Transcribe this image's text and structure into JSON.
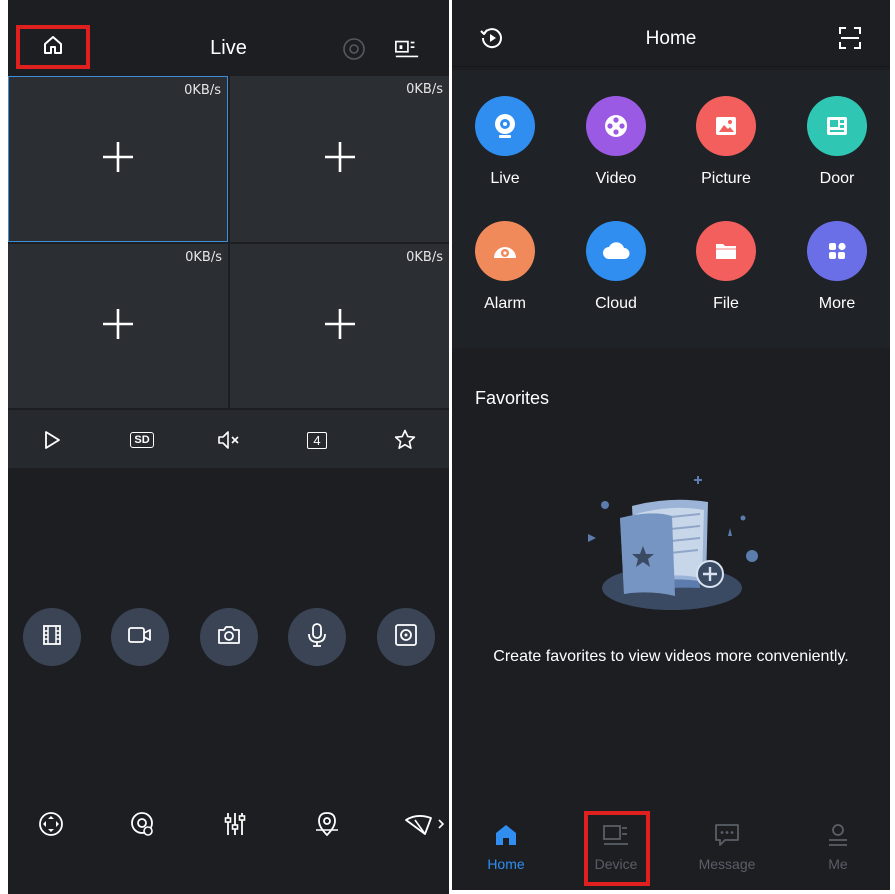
{
  "left": {
    "title": "Live",
    "channels": [
      {
        "rate": "0KB/s",
        "selected": true
      },
      {
        "rate": "0KB/s",
        "selected": false
      },
      {
        "rate": "0KB/s",
        "selected": false
      },
      {
        "rate": "0KB/s",
        "selected": false
      }
    ],
    "controls": {
      "quality_label": "SD",
      "split_label": "4"
    },
    "icons": [
      "home-icon",
      "record-dot-icon",
      "device-list-icon",
      "play-icon",
      "sd-icon",
      "mute-icon",
      "split-icon",
      "star-icon",
      "film-icon",
      "video-record-icon",
      "camera-icon",
      "microphone-icon",
      "ptz-icon",
      "ptz-rotate-icon",
      "fisheye-icon",
      "equalizer-icon",
      "location-icon",
      "wiper-icon"
    ]
  },
  "right": {
    "title": "Home",
    "apps": [
      {
        "label": "Live",
        "color": "#2f8ef0"
      },
      {
        "label": "Video",
        "color": "#9a5ae3"
      },
      {
        "label": "Picture",
        "color": "#f25f5c"
      },
      {
        "label": "Door",
        "color": "#2fc7b4"
      },
      {
        "label": "Alarm",
        "color": "#f08a5a"
      },
      {
        "label": "Cloud",
        "color": "#2f8ef0"
      },
      {
        "label": "File",
        "color": "#f25f5c"
      },
      {
        "label": "More",
        "color": "#6a6fe8"
      }
    ],
    "favorites": {
      "title": "Favorites",
      "message": "Create favorites to view videos more conveniently."
    },
    "tabs": [
      {
        "label": "Home",
        "active": true
      },
      {
        "label": "Device",
        "active": false
      },
      {
        "label": "Message",
        "active": false
      },
      {
        "label": "Me",
        "active": false
      }
    ],
    "colors": {
      "active_tab": "#2f8ef0",
      "inactive_tab": "#5a5e66",
      "highlight": "#e0201f"
    }
  }
}
